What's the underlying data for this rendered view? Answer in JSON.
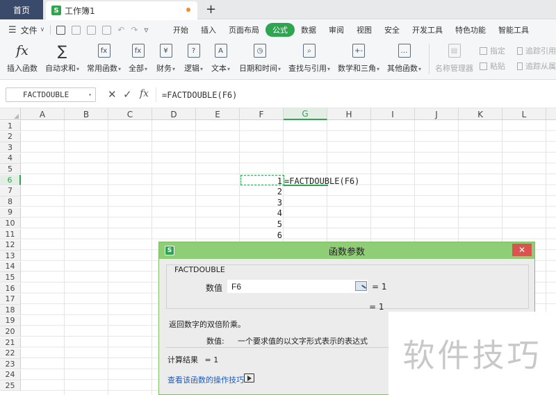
{
  "titlebar": {
    "home_tab": "首页",
    "doc_tab": "工作簿1",
    "doc_logo": "S",
    "new_tab": "+"
  },
  "menubar": {
    "file_label": "文件",
    "tabs": [
      "开始",
      "插入",
      "页面布局",
      "公式",
      "数据",
      "审阅",
      "视图",
      "安全",
      "开发工具",
      "特色功能",
      "智能工具"
    ],
    "active_tab": "公式"
  },
  "ribbon": {
    "buttons": [
      {
        "label": "插入函数",
        "icon": "fx-icon",
        "glyph": "fx"
      },
      {
        "label": "自动求和",
        "icon": "sigma-icon",
        "glyph": "∑",
        "dropdown": true
      },
      {
        "label": "常用函数",
        "icon": "common-func-icon",
        "glyph": "fx",
        "dropdown": true
      },
      {
        "label": "全部",
        "icon": "all-func-icon",
        "glyph": "fx",
        "dropdown": true
      },
      {
        "label": "财务",
        "icon": "finance-icon",
        "glyph": "¥",
        "dropdown": true
      },
      {
        "label": "逻辑",
        "icon": "logic-icon",
        "glyph": "?",
        "dropdown": true
      },
      {
        "label": "文本",
        "icon": "text-icon",
        "glyph": "A",
        "dropdown": true
      },
      {
        "label": "日期和时间",
        "icon": "datetime-icon",
        "glyph": "◷",
        "dropdown": true
      },
      {
        "label": "查找与引用",
        "icon": "lookup-icon",
        "glyph": "⌕",
        "dropdown": true
      },
      {
        "label": "数学和三角",
        "icon": "math-icon",
        "glyph": "+-",
        "dropdown": true
      },
      {
        "label": "其他函数",
        "icon": "other-func-icon",
        "glyph": "…",
        "dropdown": true
      },
      {
        "label": "名称管理器",
        "icon": "name-manager-icon",
        "glyph": "▤",
        "disabled": true
      }
    ],
    "small": {
      "specify": "指定",
      "paste": "粘贴",
      "trace_precedents": "追踪引用",
      "trace_dependents": "追踪从属"
    },
    "dropdown_arrow": "▾"
  },
  "formula_bar": {
    "name_box": "FACTDOUBLE",
    "cancel": "✕",
    "confirm": "✓",
    "fx": "fx",
    "formula": "=FACTDOUBLE(F6)"
  },
  "grid": {
    "columns": [
      "A",
      "B",
      "C",
      "D",
      "E",
      "F",
      "G",
      "H",
      "I",
      "J",
      "K",
      "L"
    ],
    "selected_column": "G",
    "rows": [
      "1",
      "2",
      "3",
      "4",
      "5",
      "6",
      "7",
      "8",
      "9",
      "10",
      "11",
      "12",
      "13",
      "14",
      "15",
      "16",
      "17",
      "18",
      "19",
      "20",
      "21",
      "22",
      "23",
      "24",
      "25"
    ],
    "selected_row": "6",
    "f_values": [
      "1",
      "2",
      "3",
      "4",
      "5",
      "6"
    ],
    "g6_formula": "=FACTDOUBLE(F6)"
  },
  "dialog": {
    "title": "函数参数",
    "close": "✕",
    "function_name": "FACTDOUBLE",
    "arg_label": "数值",
    "arg_value": "F6",
    "arg_result": "= 1",
    "result_line": "= 1",
    "description": "返回数字的双倍阶乘。",
    "param_name": "数值:",
    "param_desc": "一个要求值的以文字形式表示的表达式",
    "calc_label": "计算结果",
    "calc_value": "= 1",
    "help_link": "查看该函数的操作技巧"
  },
  "watermark": "软件技巧",
  "colors": {
    "accent": "#2fa552",
    "dialog_title": "#8fce76",
    "close_button": "#d9534f",
    "home_tab": "#3a4a6b"
  }
}
